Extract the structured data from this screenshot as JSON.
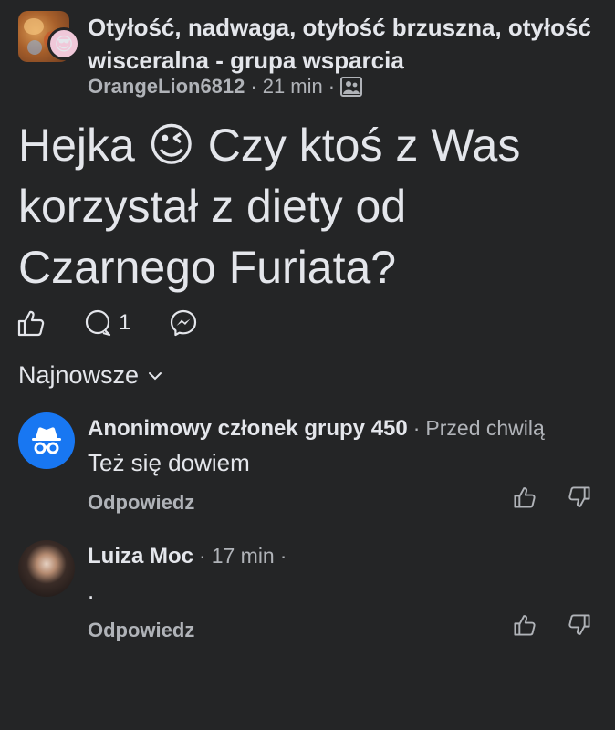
{
  "post": {
    "group_name": "Otyłość, nadwaga, otyłość brzuszna, otyłość wisceralna - grupa wsparcia",
    "author": "OrangeLion6812",
    "separator": "·",
    "time": "21 min",
    "text": "Hejka 😉 Czy ktoś z Was korzystał z diety od Czarnego Furiata?",
    "comment_count": "1"
  },
  "sort": {
    "label": "Najnowsze"
  },
  "comments": [
    {
      "author": "Anonimowy członek grupy 450",
      "time": "Przed chwilą",
      "text": "Też się dowiem",
      "reply_label": "Odpowiedz"
    },
    {
      "author": "Luiza Moc",
      "time": "17 min",
      "text": ".",
      "reply_label": "Odpowiedz"
    }
  ],
  "icons": {
    "like": "thumbs-up-icon",
    "comment": "comment-bubble-icon",
    "share": "messenger-icon",
    "group": "group-icon",
    "upvote": "thumbs-up-icon",
    "downvote": "thumbs-down-icon",
    "anonymous": "incognito-icon"
  },
  "colors": {
    "background": "#242526",
    "text_primary": "#e4e6eb",
    "text_secondary": "#b0b3b8",
    "anon_avatar": "#1877f2"
  }
}
